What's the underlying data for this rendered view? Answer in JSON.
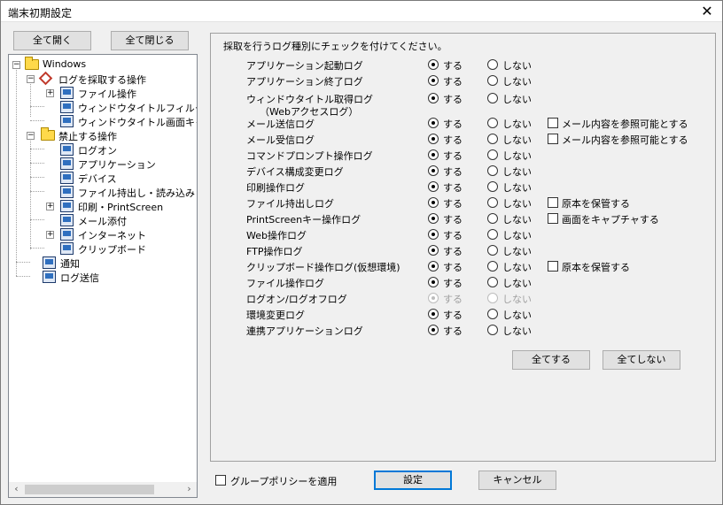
{
  "window": {
    "title": "端末初期設定",
    "close_glyph": "✕"
  },
  "tree_buttons": {
    "expand_all": "全て開く",
    "collapse_all": "全て閉じる"
  },
  "tree": {
    "root": "Windows",
    "log_ops": "ログを採取する操作",
    "file_ops": "ファイル操作",
    "window_title_filter": "ウィンドウタイトルフィルタ",
    "window_title_capture": "ウィンドウタイトル画面キャ",
    "prohibited_ops": "禁止する操作",
    "logon": "ログオン",
    "application": "アプリケーション",
    "device": "デバイス",
    "file_export": "ファイル持出し・読み込み",
    "print": "印刷・PrintScreen",
    "mail_attach": "メール添付",
    "internet": "インターネット",
    "clipboard": "クリップボード",
    "notify": "通知",
    "log_send": "ログ送信"
  },
  "panel": {
    "instruction": "採取を行うログ種別にチェックを付けてください。",
    "yes_label": "する",
    "no_label": "しない",
    "rows": [
      {
        "name": "アプリケーション起動ログ",
        "value": "yes",
        "option": ""
      },
      {
        "name": "アプリケーション終了ログ",
        "value": "yes",
        "option": ""
      },
      {
        "name": "ウィンドウタイトル取得ログ",
        "name2": "（Webアクセスログ）",
        "value": "yes",
        "option": ""
      },
      {
        "name": "メール送信ログ",
        "value": "yes",
        "option": "メール内容を参照可能とする"
      },
      {
        "name": "メール受信ログ",
        "value": "yes",
        "option": "メール内容を参照可能とする"
      },
      {
        "name": "コマンドプロンプト操作ログ",
        "value": "yes",
        "option": ""
      },
      {
        "name": "デバイス構成変更ログ",
        "value": "yes",
        "option": ""
      },
      {
        "name": "印刷操作ログ",
        "value": "yes",
        "option": ""
      },
      {
        "name": "ファイル持出しログ",
        "value": "yes",
        "option": "原本を保管する"
      },
      {
        "name": "PrintScreenキー操作ログ",
        "value": "yes",
        "option": "画面をキャプチャする"
      },
      {
        "name": "Web操作ログ",
        "value": "yes",
        "option": ""
      },
      {
        "name": "FTP操作ログ",
        "value": "yes",
        "option": ""
      },
      {
        "name": "クリップボード操作ログ(仮想環境)",
        "value": "yes",
        "option": "原本を保管する"
      },
      {
        "name": "ファイル操作ログ",
        "value": "yes",
        "option": ""
      },
      {
        "name": "ログオン/ログオフログ",
        "value": "yes",
        "option": "",
        "disabled": true
      },
      {
        "name": "環境変更ログ",
        "value": "yes",
        "option": ""
      },
      {
        "name": "連携アプリケーションログ",
        "value": "yes",
        "option": ""
      }
    ],
    "all_yes": "全てする",
    "all_no": "全てしない"
  },
  "footer": {
    "group_policy": "グループポリシーを適用",
    "apply": "設定",
    "cancel": "キャンセル"
  }
}
